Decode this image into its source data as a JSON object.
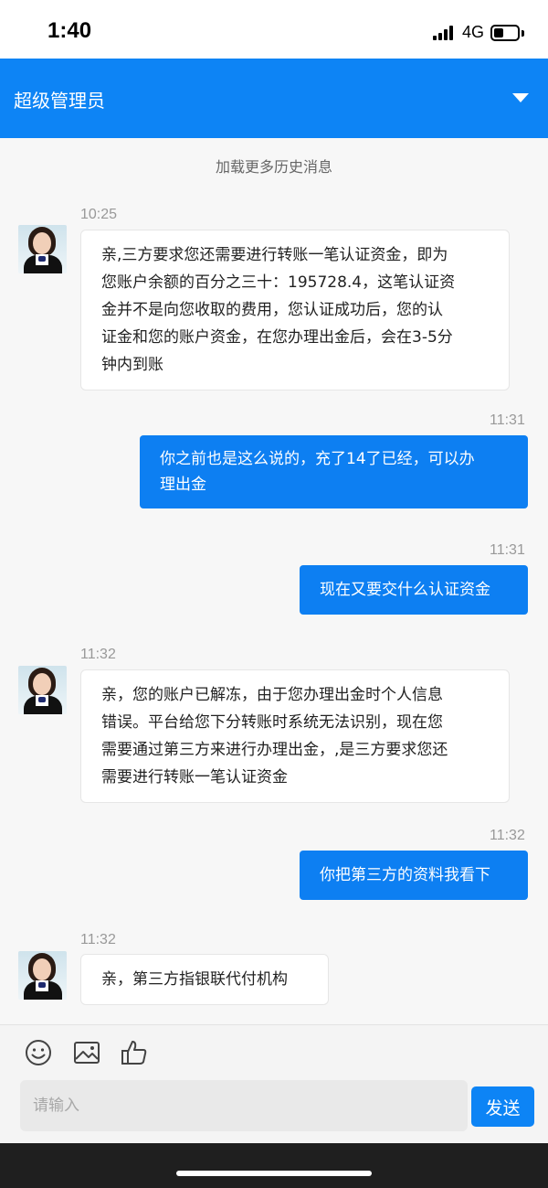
{
  "status_bar": {
    "time": "1:40",
    "network": "4G",
    "battery_level": 0.4
  },
  "header": {
    "title": "超级管理员",
    "toggle_icon": "chevron-down-icon"
  },
  "chat": {
    "load_more": "加载更多历史消息",
    "messages": [
      {
        "side": "incoming",
        "time": "10:25",
        "lines": [
          "亲,三方要求您还需要进行转账一笔认证资金，即为",
          "您账户余额的百分之三十：195728.4，这笔认证资",
          "金并不是向您收取的费用，您认证成功后，您的认",
          "证金和您的账户资金，在您办理出金后，会在3-5分",
          "钟内到账"
        ]
      },
      {
        "side": "outgoing",
        "time": "11:31",
        "lines": [
          "你之前也是这么说的，充了14了已经，可以办",
          "理出金"
        ]
      },
      {
        "side": "outgoing",
        "time": "11:31",
        "lines": [
          "现在又要交什么认证资金"
        ]
      },
      {
        "side": "incoming",
        "time": "11:32",
        "lines": [
          "亲，您的账户已解冻，由于您办理出金时个人信息",
          "错误。平台给您下分转账时系统无法识别，现在您",
          "需要通过第三方来进行办理出金，,是三方要求您还",
          "需要进行转账一笔认证资金"
        ]
      },
      {
        "side": "outgoing",
        "time": "11:32",
        "lines": [
          "你把第三方的资料我看下"
        ]
      },
      {
        "side": "incoming",
        "time": "11:32",
        "lines": [
          "亲，第三方指银联代付机构"
        ]
      }
    ]
  },
  "input": {
    "placeholder": "请输入",
    "send_label": "发送",
    "tools": [
      "emoji-icon",
      "image-icon",
      "thumbs-up-icon"
    ]
  },
  "colors": {
    "brand": "#0d84f5",
    "outgoing_bubble": "#0d7ff2",
    "incoming_bubble": "#ffffff"
  }
}
